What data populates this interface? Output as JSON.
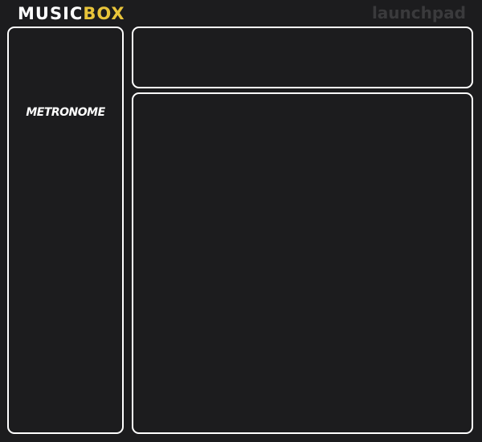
{
  "header": {
    "logo_part1": "MUSIC",
    "logo_part2": "BOX",
    "brand": "launchpad",
    "colors": {
      "logo_primary": "#ffffff",
      "logo_accent": "#e8c43a",
      "brand": "#3a3a3c",
      "background": "#1c1c1e"
    }
  },
  "sidebar": {
    "items": [
      {
        "label": "METRONOME"
      }
    ]
  },
  "top_panel": {},
  "main_panel": {}
}
